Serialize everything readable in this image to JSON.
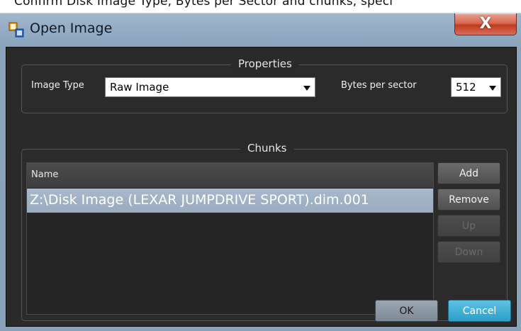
{
  "caption": "Confirm Disk Image Type, Bytes per Sector and chunks, speci",
  "window": {
    "title": "Open Image",
    "close_label": "X"
  },
  "properties": {
    "legend": "Properties",
    "image_type_label": "Image Type",
    "image_type_value": "Raw Image",
    "bytes_per_sector_label": "Bytes per sector",
    "bytes_per_sector_value": "512"
  },
  "chunks": {
    "legend": "Chunks",
    "column_header": "Name",
    "rows": [
      {
        "name": "Z:\\Disk Image (LEXAR JUMPDRIVE SPORT).dim.001",
        "selected": true
      }
    ],
    "buttons": {
      "add": "Add",
      "remove": "Remove",
      "up": "Up",
      "down": "Down"
    }
  },
  "footer": {
    "ok": "OK",
    "cancel": "Cancel"
  },
  "colors": {
    "selection": "#a9b8ca",
    "accent_cancel": "#2c9ec8",
    "close": "#c23a1e"
  },
  "icons": {
    "app": "open-image-app-icon",
    "close": "close-icon",
    "dropdown": "chevron-down-icon"
  }
}
